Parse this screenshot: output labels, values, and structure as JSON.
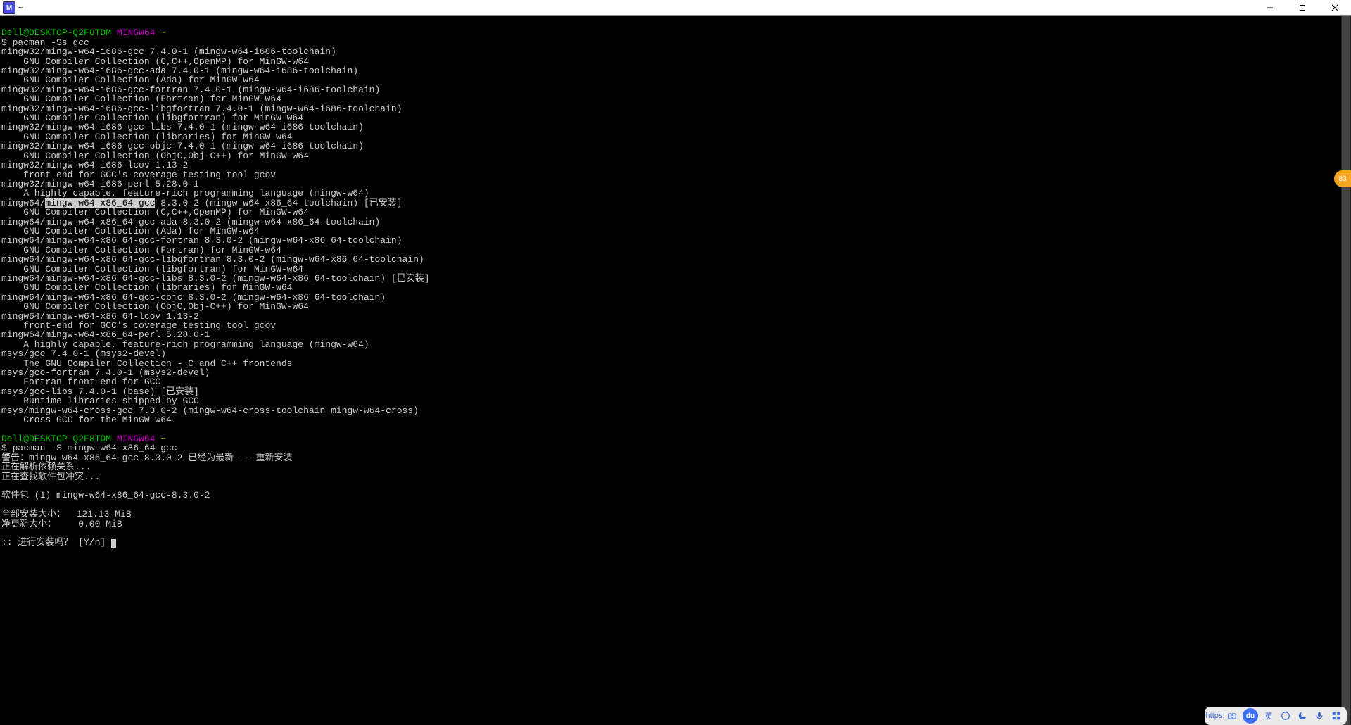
{
  "window": {
    "title": "~",
    "app_badge": "M"
  },
  "prompt": {
    "user_host": "Dell@DESKTOP-Q2F8TDM",
    "env": "MINGW64",
    "path": "~"
  },
  "cmd1": "pacman -Ss gcc",
  "packages": [
    {
      "name": "mingw32/mingw-w64-i686-gcc 7.4.0-1 (mingw-w64-i686-toolchain)",
      "desc": "GNU Compiler Collection (C,C++,OpenMP) for MinGW-w64"
    },
    {
      "name": "mingw32/mingw-w64-i686-gcc-ada 7.4.0-1 (mingw-w64-i686-toolchain)",
      "desc": "GNU Compiler Collection (Ada) for MinGW-w64"
    },
    {
      "name": "mingw32/mingw-w64-i686-gcc-fortran 7.4.0-1 (mingw-w64-i686-toolchain)",
      "desc": "GNU Compiler Collection (Fortran) for MinGW-w64"
    },
    {
      "name": "mingw32/mingw-w64-i686-gcc-libgfortran 7.4.0-1 (mingw-w64-i686-toolchain)",
      "desc": "GNU Compiler Collection (libgfortran) for MinGW-w64"
    },
    {
      "name": "mingw32/mingw-w64-i686-gcc-libs 7.4.0-1 (mingw-w64-i686-toolchain)",
      "desc": "GNU Compiler Collection (libraries) for MinGW-w64"
    },
    {
      "name": "mingw32/mingw-w64-i686-gcc-objc 7.4.0-1 (mingw-w64-i686-toolchain)",
      "desc": "GNU Compiler Collection (ObjC,Obj-C++) for MinGW-w64"
    },
    {
      "name": "mingw32/mingw-w64-i686-lcov 1.13-2",
      "desc": "front-end for GCC's coverage testing tool gcov"
    },
    {
      "name": "mingw32/mingw-w64-i686-perl 5.28.0-1",
      "desc": "A highly capable, feature-rich programming language (mingw-w64)"
    }
  ],
  "selected_pkg": {
    "prefix": "mingw64/",
    "name": "mingw-w64-x86_64-gcc",
    "rest": " 8.3.0-2 (mingw-w64-x86_64-toolchain) ",
    "installed": "[已安装]",
    "desc": "GNU Compiler Collection (C,C++,OpenMP) for MinGW-w64"
  },
  "packages2": [
    {
      "name": "mingw64/mingw-w64-x86_64-gcc-ada 8.3.0-2 (mingw-w64-x86_64-toolchain)",
      "desc": "GNU Compiler Collection (Ada) for MinGW-w64"
    },
    {
      "name": "mingw64/mingw-w64-x86_64-gcc-fortran 8.3.0-2 (mingw-w64-x86_64-toolchain)",
      "desc": "GNU Compiler Collection (Fortran) for MinGW-w64"
    },
    {
      "name": "mingw64/mingw-w64-x86_64-gcc-libgfortran 8.3.0-2 (mingw-w64-x86_64-toolchain)",
      "desc": "GNU Compiler Collection (libgfortran) for MinGW-w64"
    }
  ],
  "pkg_libs_installed": {
    "name": "mingw64/mingw-w64-x86_64-gcc-libs 8.3.0-2 (mingw-w64-x86_64-toolchain) ",
    "installed": "[已安装]",
    "desc": "GNU Compiler Collection (libraries) for MinGW-w64"
  },
  "packages3": [
    {
      "name": "mingw64/mingw-w64-x86_64-gcc-objc 8.3.0-2 (mingw-w64-x86_64-toolchain)",
      "desc": "GNU Compiler Collection (ObjC,Obj-C++) for MinGW-w64"
    },
    {
      "name": "mingw64/mingw-w64-x86_64-lcov 1.13-2",
      "desc": "front-end for GCC's coverage testing tool gcov"
    },
    {
      "name": "mingw64/mingw-w64-x86_64-perl 5.28.0-1",
      "desc": "A highly capable, feature-rich programming language (mingw-w64)"
    },
    {
      "name": "msys/gcc 7.4.0-1 (msys2-devel)",
      "desc": "The GNU Compiler Collection - C and C++ frontends"
    },
    {
      "name": "msys/gcc-fortran 7.4.0-1 (msys2-devel)",
      "desc": "Fortran front-end for GCC"
    }
  ],
  "pkg_base_installed": {
    "name": "msys/gcc-libs 7.4.0-1 (base) ",
    "installed": "[已安装]",
    "desc": "Runtime libraries shipped by GCC"
  },
  "packages4": [
    {
      "name": "msys/mingw-w64-cross-gcc 7.3.0-2 (mingw-w64-cross-toolchain mingw-w64-cross)",
      "desc": "Cross GCC for the MinGW-w64"
    }
  ],
  "cmd2": "pacman -S mingw-w64-x86_64-gcc",
  "install_lines": {
    "warn_prefix": "警告：",
    "warn_rest": "mingw-w64-x86_64-gcc-8.3.0-2 已经为最新 -- 重新安装",
    "line1": "正在解析依赖关系...",
    "line2": "正在查找软件包冲突...",
    "pkg_line": "软件包 (1) mingw-w64-x86_64-gcc-8.3.0-2",
    "size_label": "全部安装大小：",
    "size_val": "121.13 MiB",
    "net_label": "净更新大小：",
    "net_val": "0.00 MiB",
    "confirm": ":: 进行安装吗？ [Y/n] "
  },
  "badge": {
    "value": "83"
  },
  "taskbar": {
    "https": "https:",
    "du": "du",
    "ime": "英"
  }
}
